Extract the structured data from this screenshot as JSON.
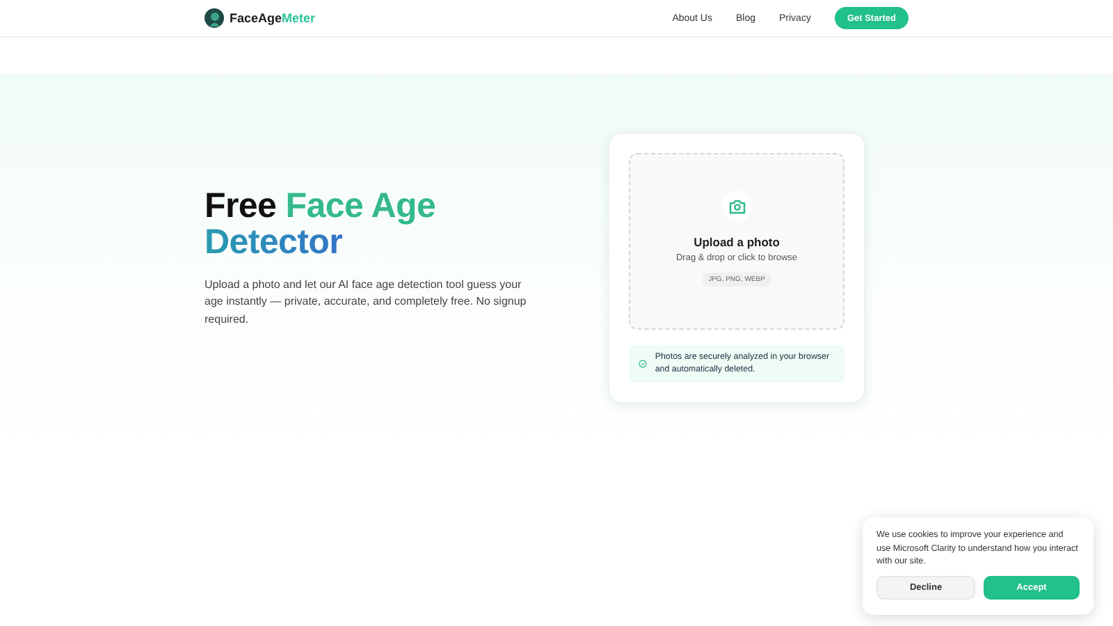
{
  "header": {
    "logo": {
      "name": "FaceAge",
      "accent": "Meter"
    },
    "nav": [
      "About Us",
      "Blog",
      "Privacy"
    ],
    "cta": "Get Started"
  },
  "hero": {
    "title": {
      "plain": "Free",
      "accent": "Face Age",
      "accent_2": "Detector"
    },
    "description": "Upload a photo and let our AI face age detection tool guess your age instantly — private, accurate, and completely free. No signup required."
  },
  "upload": {
    "title": "Upload a photo",
    "hint": "Drag & drop or click to browse",
    "formats": "JPG, PNG, WEBP",
    "notice": "Photos are securely analyzed in your browser and automatically deleted."
  },
  "cookie_banner": {
    "message": "We use cookies to improve your experience and use Microsoft Clarity to understand how you interact with our site.",
    "buttons": [
      "Decline",
      "Accept"
    ]
  }
}
